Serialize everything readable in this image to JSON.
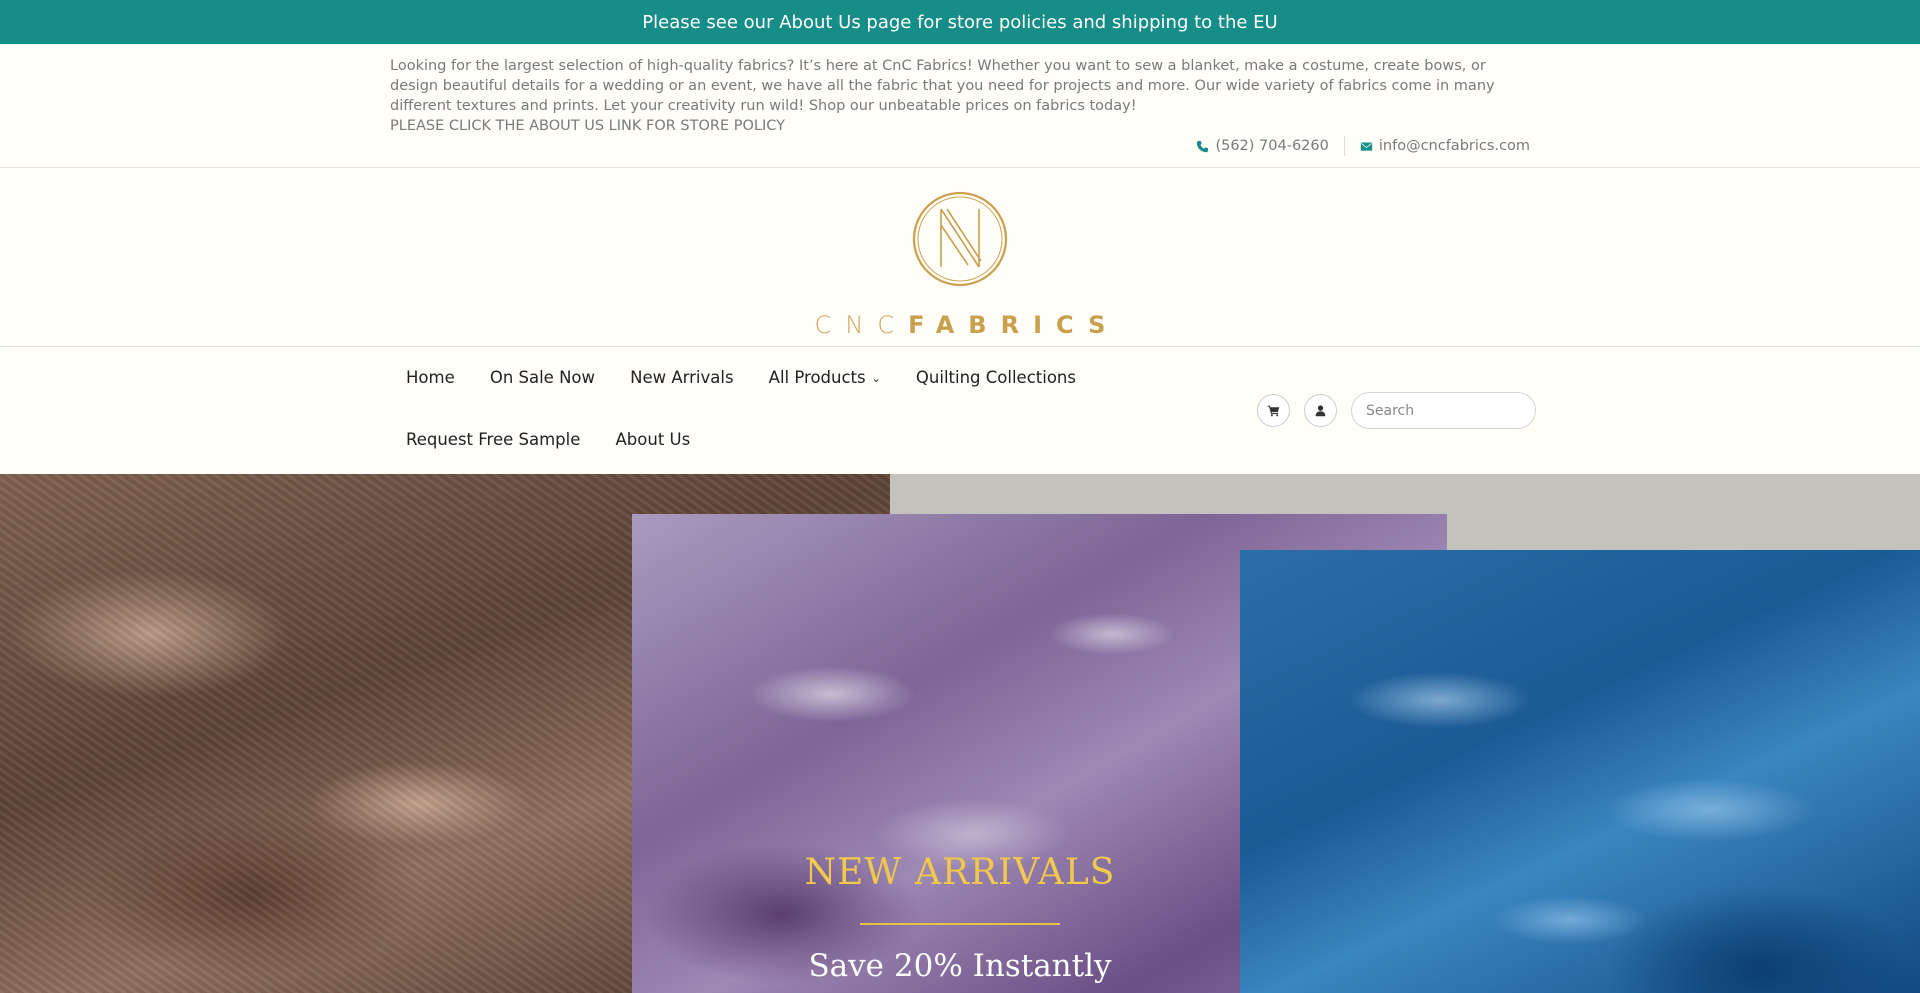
{
  "announcement": "Please see our About Us page for store policies and shipping to the EU",
  "header": {
    "description": "Looking for the largest selection of high-quality fabrics? It’s here at CnC Fabrics! Whether you want to sew a blanket, make a costume, create bows, or design beautiful details for a wedding or an event, we have all the fabric that you need for projects and more. Our wide variety of fabrics come in many different textures and prints. Let your creativity run wild! Shop our unbeatable prices on fabrics today!",
    "policy_note": "PLEASE CLICK THE ABOUT US LINK FOR STORE POLICY",
    "phone": "(562) 704-6260",
    "email": "info@cncfabrics.com",
    "phone_icon": "phone-icon",
    "email_icon": "envelope-icon"
  },
  "logo": {
    "part1": "CNC",
    "part2": "FABRICS",
    "color": "#c9a04e"
  },
  "nav": {
    "items": [
      {
        "label": "Home"
      },
      {
        "label": "On Sale Now"
      },
      {
        "label": "New Arrivals"
      },
      {
        "label": "All Products",
        "has_dropdown": true
      },
      {
        "label": "Quilting Collections"
      },
      {
        "label": "Request Free Sample"
      },
      {
        "label": "About Us"
      }
    ],
    "cart_icon": "cart-icon",
    "account_icon": "user-icon",
    "search_placeholder": "Search"
  },
  "hero": {
    "title": "NEW ARRIVALS",
    "subtitle": "Save 20% Instantly",
    "accent_color": "#f0c84c"
  },
  "colors": {
    "brand_teal": "#168d86",
    "background": "#fffef8"
  }
}
